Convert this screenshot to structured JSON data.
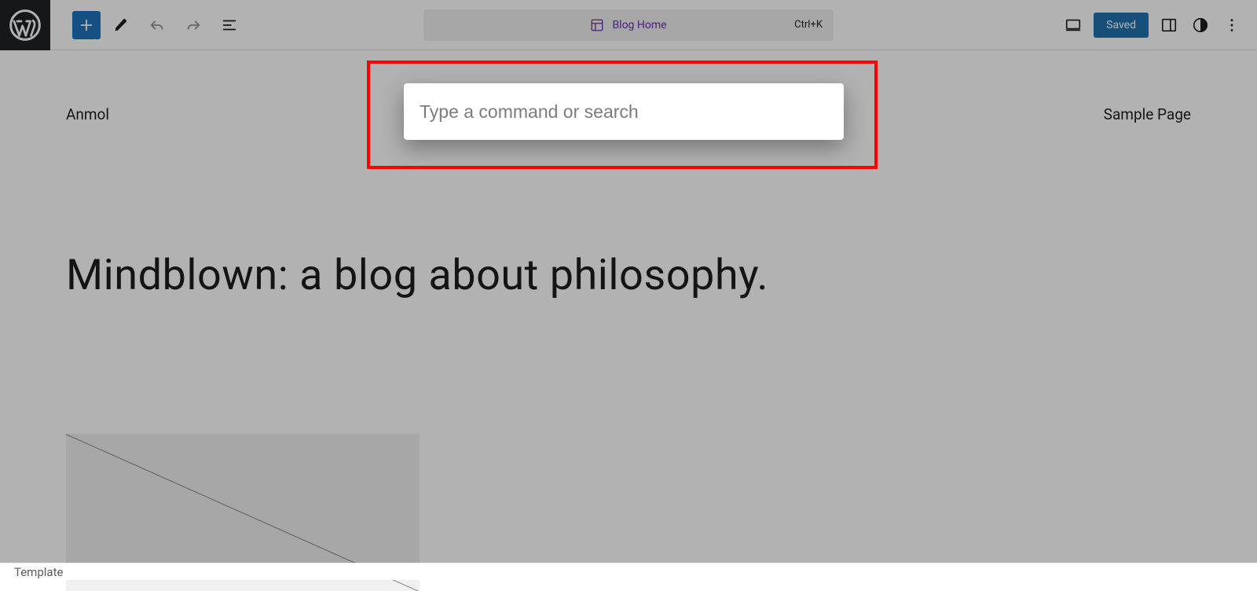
{
  "toolbar": {
    "center_label": "Blog Home",
    "shortcut": "Ctrl+K",
    "saved_label": "Saved"
  },
  "canvas": {
    "site_title": "Anmol",
    "nav_link": "Sample Page",
    "hero": "Mindblown: a blog about philosophy."
  },
  "command": {
    "placeholder": "Type a command or search"
  },
  "footer": {
    "breadcrumb": "Template"
  }
}
